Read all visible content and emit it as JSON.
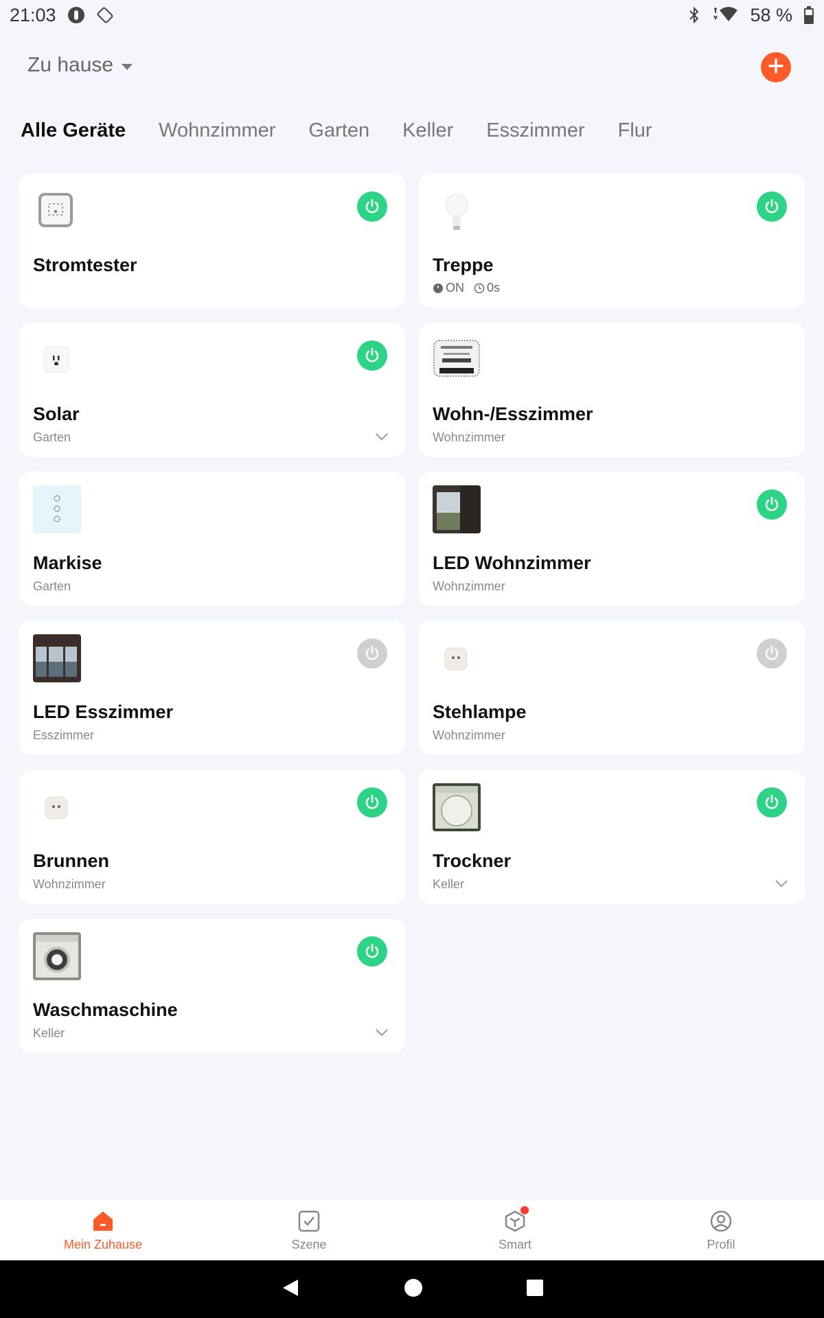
{
  "status_bar": {
    "time": "21:03",
    "battery": "58 %",
    "icons": [
      "notification-icon",
      "rotate-icon",
      "bluetooth-icon",
      "data-arrows-icon",
      "wifi-icon",
      "battery-icon"
    ]
  },
  "header": {
    "home_label": "Zu hause",
    "add_icon": "plus-icon"
  },
  "tabs": [
    {
      "label": "Alle Geräte",
      "active": true
    },
    {
      "label": "Wohnzimmer",
      "active": false
    },
    {
      "label": "Garten",
      "active": false
    },
    {
      "label": "Keller",
      "active": false
    },
    {
      "label": "Esszimmer",
      "active": false
    },
    {
      "label": "Flur",
      "active": false
    }
  ],
  "devices": [
    {
      "name": "Stromtester",
      "room": "",
      "icon": "plug-box-icon",
      "power": "on",
      "expand": false
    },
    {
      "name": "Treppe",
      "room": "",
      "icon": "bulb-icon",
      "power": "on",
      "expand": false,
      "status_on": "ON",
      "status_timer": "0s"
    },
    {
      "name": "Solar",
      "room": "Garten",
      "icon": "outlet-icon",
      "power": "on",
      "expand": true
    },
    {
      "name": "Wohn-/Esszimmer",
      "room": "Wohnzimmer",
      "icon": "relay-module-icon",
      "power": "none",
      "expand": false
    },
    {
      "name": "Markise",
      "room": "Garten",
      "icon": "blind-switch-icon",
      "power": "none",
      "expand": false
    },
    {
      "name": "LED Wohnzimmer",
      "room": "Wohnzimmer",
      "icon": "window-photo-icon",
      "power": "on",
      "expand": false
    },
    {
      "name": "LED Esszimmer",
      "room": "Esszimmer",
      "icon": "room-photo-icon",
      "power": "off",
      "expand": false
    },
    {
      "name": "Stehlampe",
      "room": "Wohnzimmer",
      "icon": "smart-plug-icon",
      "power": "off",
      "expand": false
    },
    {
      "name": "Brunnen",
      "room": "Wohnzimmer",
      "icon": "smart-plug-icon",
      "power": "on",
      "expand": false
    },
    {
      "name": "Trockner",
      "room": "Keller",
      "icon": "dryer-photo-icon",
      "power": "on",
      "expand": true
    },
    {
      "name": "Waschmaschine",
      "room": "Keller",
      "icon": "washer-photo-icon",
      "power": "on",
      "expand": true
    }
  ],
  "bottom_nav": [
    {
      "label": "Mein Zuhause",
      "icon": "home-icon",
      "active": true
    },
    {
      "label": "Szene",
      "icon": "scene-check-icon",
      "active": false
    },
    {
      "label": "Smart",
      "icon": "smart-cube-icon",
      "active": false,
      "badge": true
    },
    {
      "label": "Profil",
      "icon": "profile-icon",
      "active": false
    }
  ],
  "colors": {
    "accent": "#ff5a28",
    "power_on": "#2ed486",
    "power_off": "#cfcfcf",
    "background": "#f4f6fc"
  }
}
